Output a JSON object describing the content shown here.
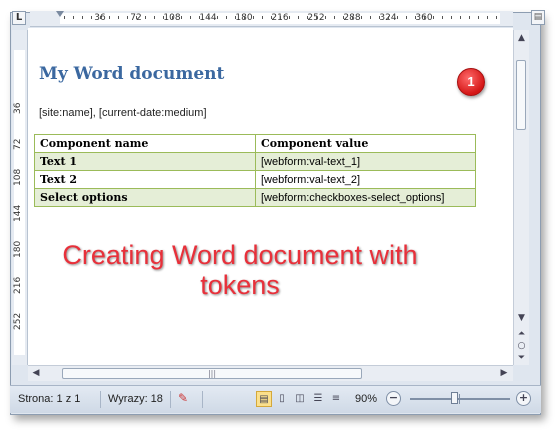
{
  "ruler": {
    "corner_label": "L",
    "h_labels": [
      "36",
      "72",
      "108",
      "144",
      "180",
      "216",
      "252",
      "288",
      "324",
      "360"
    ],
    "v_labels": [
      "36",
      "72",
      "108",
      "144",
      "180",
      "216",
      "252"
    ],
    "toggle_icon": "view-ruler-icon"
  },
  "document": {
    "title": "My Word document",
    "line": "[site:name],  [current-date:medium]",
    "table": {
      "headers": [
        "Component name",
        "Component value"
      ],
      "rows": [
        {
          "name": "Text 1",
          "value": "[webform:val-text_1]"
        },
        {
          "name": "Text 2",
          "value": "[webform:val-text_2]"
        },
        {
          "name": "Select options",
          "value": "[webform:checkboxes-select_options]"
        }
      ]
    }
  },
  "annotation": {
    "badge": "1",
    "caption_line1": "Creating Word document with",
    "caption_line2": "tokens"
  },
  "status": {
    "page": "Strona: 1 z 1",
    "words": "Wyrazy: 18",
    "zoom": "90%",
    "zoom_level_percent": 90
  },
  "colors": {
    "title": "#3b68a0",
    "table_border": "#9bbb59",
    "table_alt_row": "#e5eed7",
    "annotation": "#e8303a",
    "badge": "#d41616"
  }
}
